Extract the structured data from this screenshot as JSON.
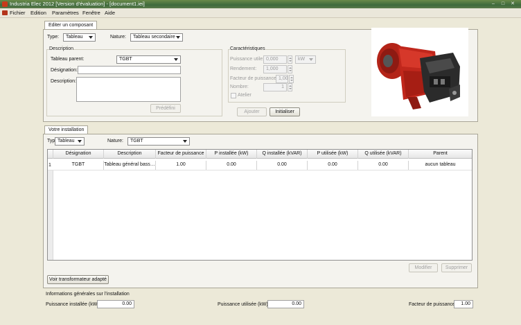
{
  "window": {
    "title": "Industria Elec 2012 [Version d'évaluation] - [document1.iei]",
    "controls": [
      "–",
      "□",
      "✕"
    ]
  },
  "menu": [
    "Fichier",
    "Edition",
    "Paramètres",
    "Fenêtre",
    "Aide"
  ],
  "editor": {
    "tab_label": "Editer un composant",
    "type_label": "Type:",
    "type_value": "Tableau",
    "nature_label": "Nature:",
    "nature_value": "Tableau secondaire",
    "description": {
      "group_title": "Description",
      "parent_label": "Tableau parent:",
      "parent_value": "TGBT",
      "designation_label": "Désignation:",
      "designation_value": "",
      "description_label": "Description:",
      "description_value": "",
      "predefined_button": "Prédéfini"
    },
    "characteristics": {
      "group_title": "Caractéristiques",
      "power_label": "Puissance utile:",
      "power_value": "0,000",
      "power_unit": "kW",
      "efficiency_label": "Rendement:",
      "efficiency_value": "1,000",
      "power_factor_label": "Facteur de puissance:",
      "power_factor_value": "1,00",
      "count_label": "Nombre:",
      "count_value": "1",
      "workshop_label": "Atelier"
    },
    "add_button": "Ajouter",
    "init_button": "Initialiser"
  },
  "installation": {
    "tab_label": "Votre installation",
    "type_label": "Type:",
    "type_value": "Tableau",
    "nature_label": "Nature:",
    "nature_value": "TGBT",
    "table": {
      "columns": [
        "Désignation",
        "Description",
        "Facteur de puissance",
        "P installée (kW)",
        "Q installée (kVAR)",
        "P utilisée (kW)",
        "Q utilisée (kVAR)",
        "Parent"
      ],
      "rows": [
        {
          "num": "1",
          "cells": [
            "TGBT",
            "Tableau général bass…",
            "1.00",
            "0.00",
            "0.00",
            "0.00",
            "0.00",
            "aucun tableau"
          ]
        }
      ]
    },
    "modify_button": "Modifier",
    "delete_button": "Supprimer",
    "transformer_button": "Voir transformateur adapté"
  },
  "general_info": {
    "title": "Informations générales sur l'installation",
    "installed_power_label": "Puissance installée (kW):",
    "installed_power_value": "0.00",
    "used_power_label": "Puissance utilisée (kW):",
    "used_power_value": "0.00",
    "power_factor_label": "Facteur de puissance:",
    "power_factor_value": "1.00"
  },
  "colors": {
    "titlebar": "#3e6a3c",
    "motor": "#c0271c"
  }
}
